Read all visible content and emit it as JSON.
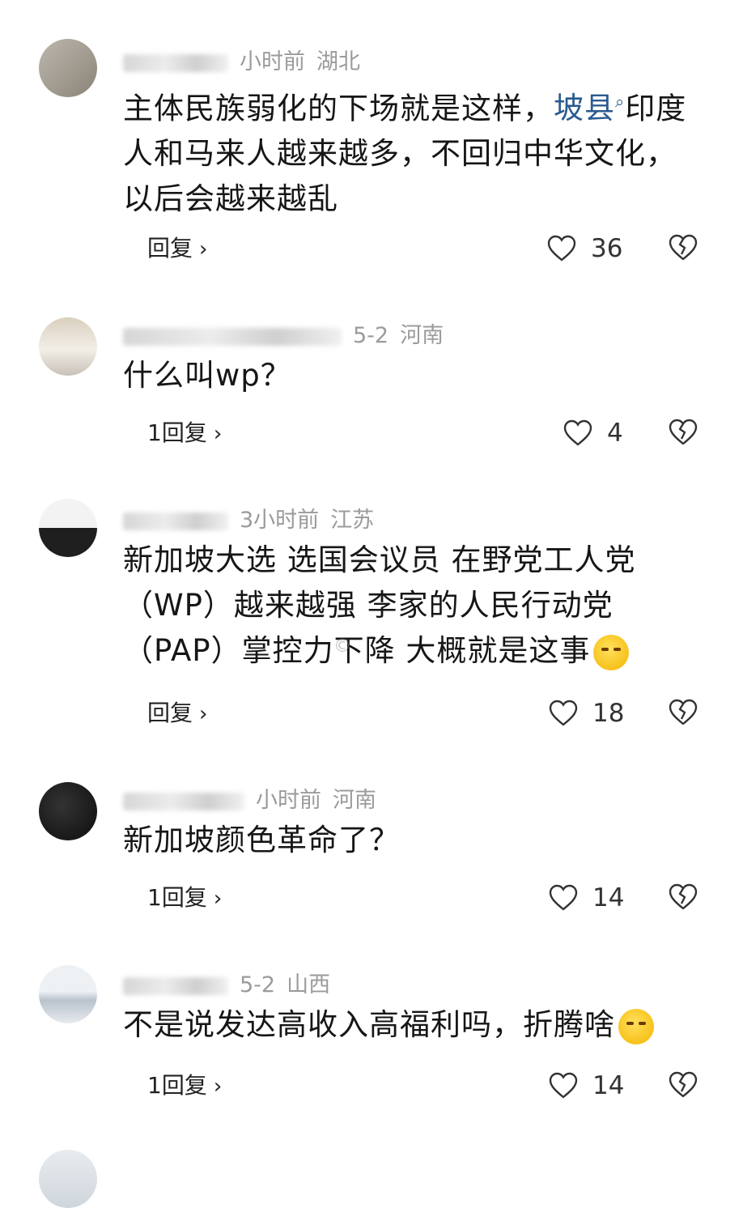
{
  "comments": [
    {
      "meta": {
        "time": "小时前",
        "region": "湖北"
      },
      "text_a": "主体民族弱化的下场就是这样，",
      "link": "坡县",
      "text_b": "印度人和马来人越来越多，不回归中华文化，以后会越来越乱",
      "reply_label": "回复",
      "likes": "36"
    },
    {
      "meta": {
        "time": "5-2",
        "region": "河南"
      },
      "text": "什么叫wp？",
      "reply_label": "1回复",
      "likes": "4"
    },
    {
      "meta": {
        "time": "3小时前",
        "region": "江苏"
      },
      "text": "新加坡大选 选国会议员 在野党工人党（WP）越来越强 李家的人民行动党（PAP）掌控力下降 大概就是这事",
      "reply_label": "回复",
      "likes": "18",
      "emoji": "smirk-emoji"
    },
    {
      "meta": {
        "time": "小时前",
        "region": "河南"
      },
      "text": "新加坡颜色革命了？",
      "reply_label": "1回复",
      "likes": "14"
    },
    {
      "meta": {
        "time": "5-2",
        "region": "山西"
      },
      "text": "不是说发达高收入高福利吗，折腾啥",
      "reply_label": "1回复",
      "likes": "14",
      "emoji": "sleepy-emoji"
    }
  ],
  "icons": {
    "reply_chevron": "chevron-right-icon",
    "like": "heart-outline-icon",
    "dislike": "broken-heart-icon",
    "link_search": "search-icon"
  },
  "colors": {
    "link": "#2a5a8f",
    "meta": "#9b9b9b",
    "text": "#161616"
  }
}
